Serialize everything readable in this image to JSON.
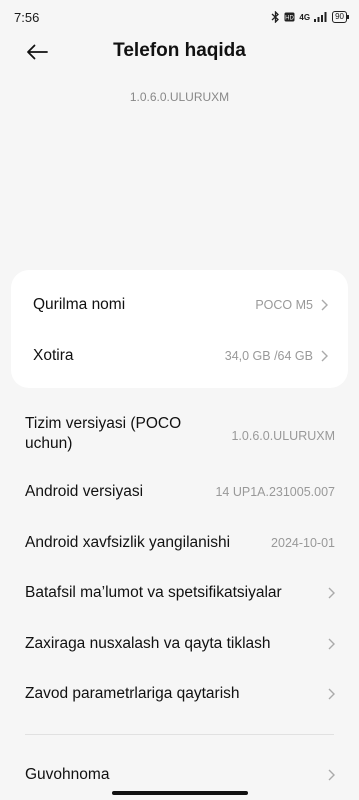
{
  "status_bar": {
    "time": "7:56",
    "network": "4G",
    "battery": "90",
    "icons": [
      "bluetooth-icon",
      "volte-icon",
      "signal-icon",
      "battery-icon"
    ]
  },
  "header": {
    "title": "Telefon haqida",
    "back_icon": "arrow-left-icon"
  },
  "version_subtitle": "1.0.6.0.ULURUXM",
  "card": {
    "device_name_label": "Qurilma nomi",
    "device_name_value": "POCO M5",
    "storage_label": "Xotira",
    "storage_value": "34,0 GB /64 GB"
  },
  "list": {
    "system_version_label": "Tizim versiyasi (POCO uchun)",
    "system_version_value": "1.0.6.0.ULURUXM",
    "android_version_label": "Android versiyasi",
    "android_version_value": "14 UP1A.231005.007",
    "security_update_label": "Android xavfsizlik yangilanishi",
    "security_update_value": "2024-10-01",
    "detailed_info_label": "Batafsil ma’lumot va spetsifikatsiyalar",
    "backup_label": "Zaxiraga nusxalash va qayta tiklash",
    "factory_reset_label": "Zavod parametrlariga qaytarish",
    "certificate_label": "Guvohnoma"
  },
  "colors": {
    "background": "#f6f6f6",
    "card": "#ffffff",
    "secondary_text": "#999999"
  }
}
